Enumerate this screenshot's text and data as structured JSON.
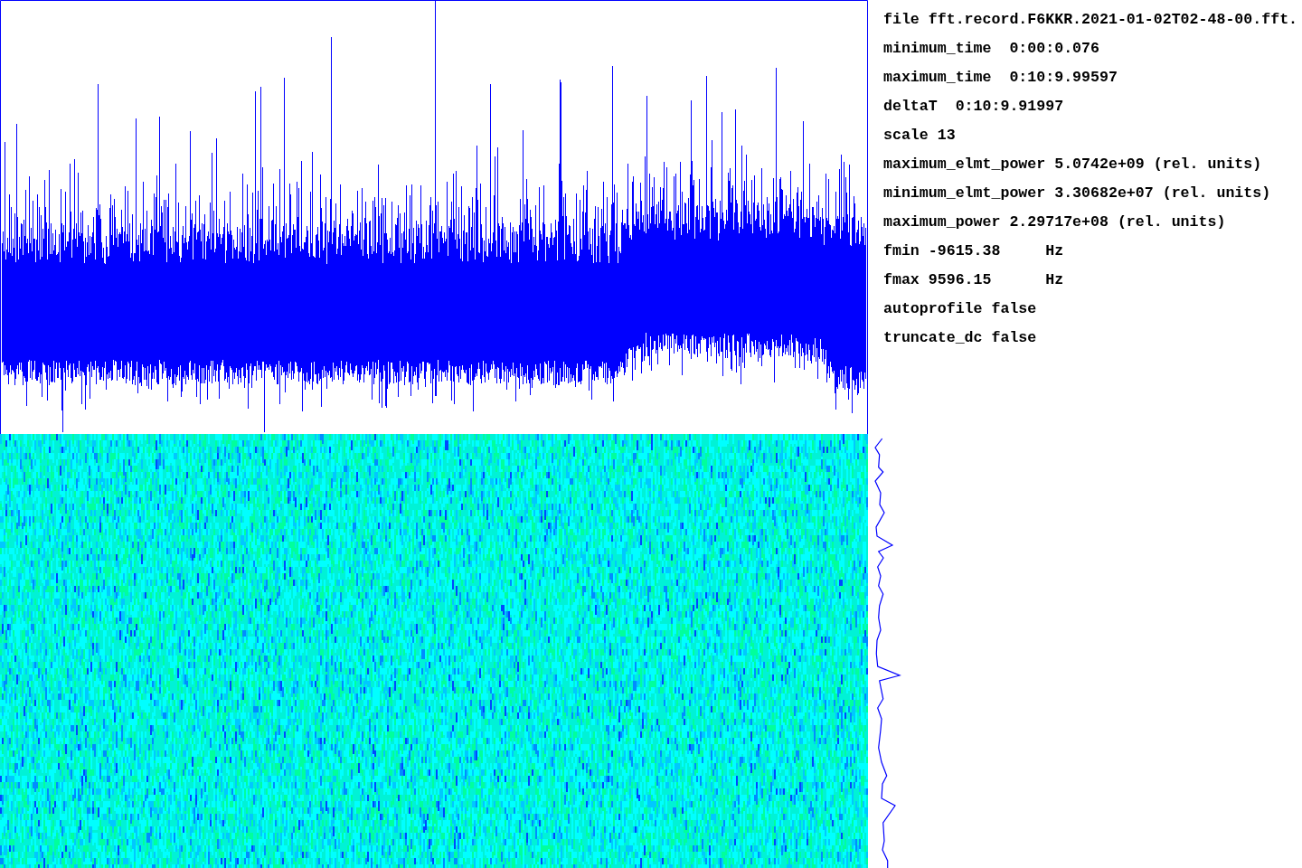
{
  "info_lines": [
    {
      "text": "file fft.record.F6KKR.2021-01-02T02-48-00.fft."
    },
    {
      "text": "minimum_time  0:00:0.076"
    },
    {
      "text": "maximum_time  0:10:9.99597"
    },
    {
      "text": "deltaT  0:10:9.91997"
    },
    {
      "text": "scale 13"
    },
    {
      "text": "maximum_elmt_power 5.0742e+09 (rel. units)"
    },
    {
      "text": "minimum_elmt_power 3.30682e+07 (rel. units)"
    },
    {
      "text": "maximum_power 2.29717e+08 (rel. units)"
    },
    {
      "text": "fmin -9615.38",
      "unit": "Hz"
    },
    {
      "text": "fmax 9596.15",
      "unit": "Hz"
    },
    {
      "text": "autoprofile false"
    },
    {
      "text": "truncate_dc false"
    }
  ]
}
